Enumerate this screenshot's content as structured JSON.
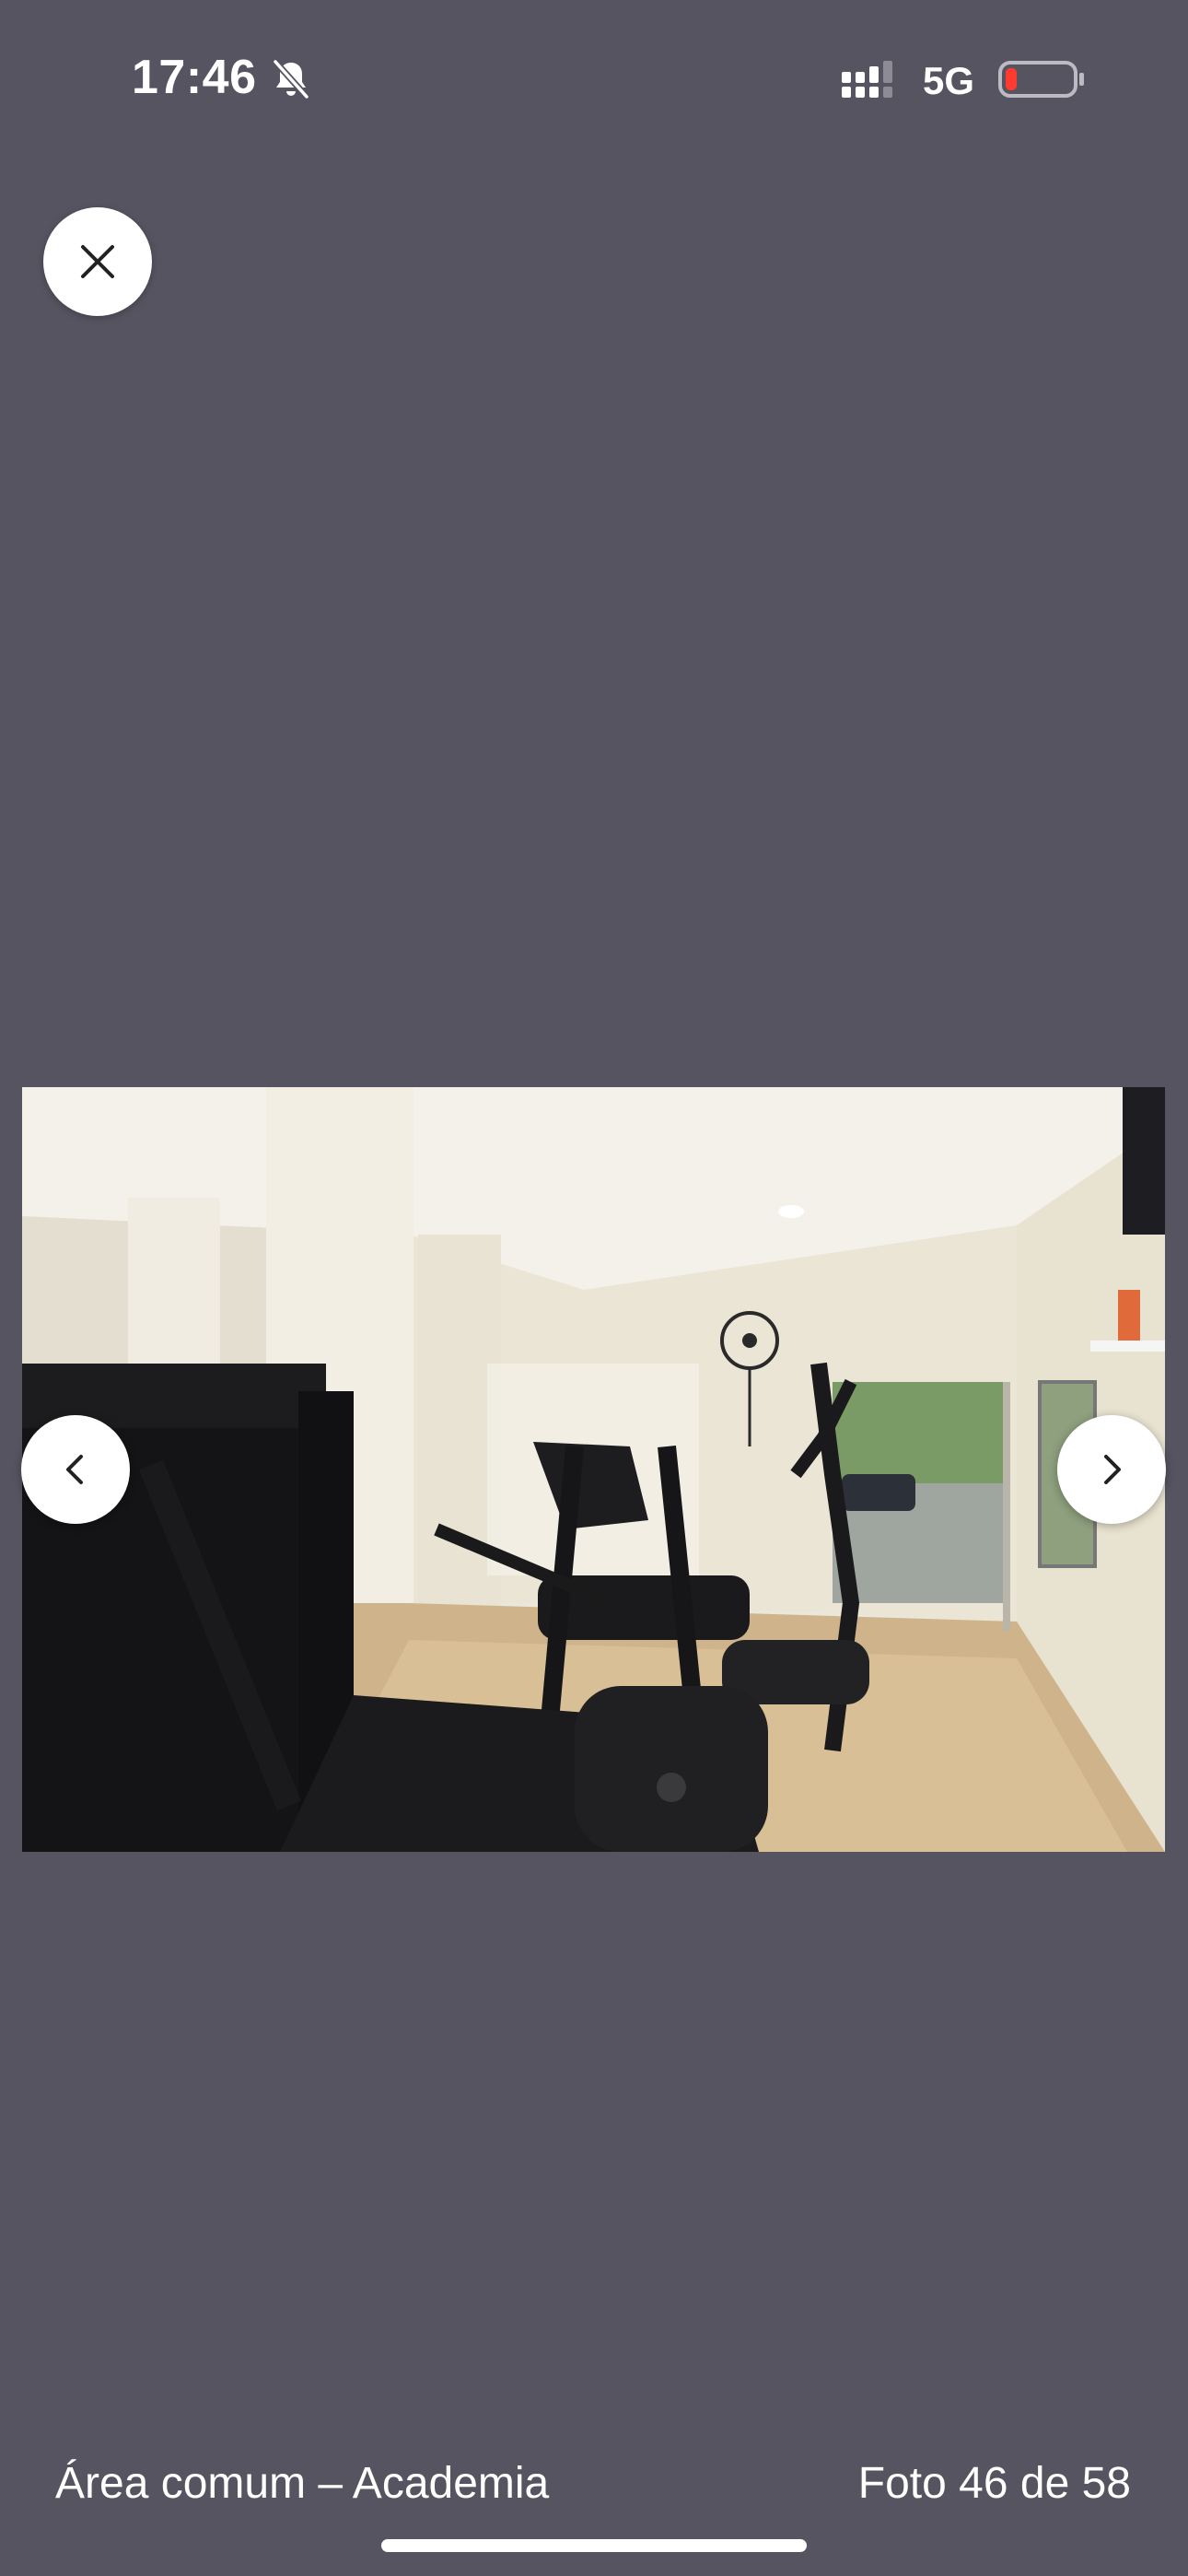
{
  "status_bar": {
    "time": "17:46",
    "network": "5G",
    "silent_icon": "bell-slash-icon",
    "signal_icon": "cellular-signal-icon",
    "battery_icon": "battery-low-icon",
    "battery_level_fraction": 0.15,
    "battery_color": "#ff3b30"
  },
  "viewer": {
    "close_icon": "close-icon",
    "prev_icon": "chevron-left-icon",
    "next_icon": "chevron-right-icon",
    "photo_content": "gym-photo",
    "background_color": "#555460"
  },
  "footer": {
    "caption": "Área comum – Academia",
    "counter": "Foto 46 de 58"
  }
}
